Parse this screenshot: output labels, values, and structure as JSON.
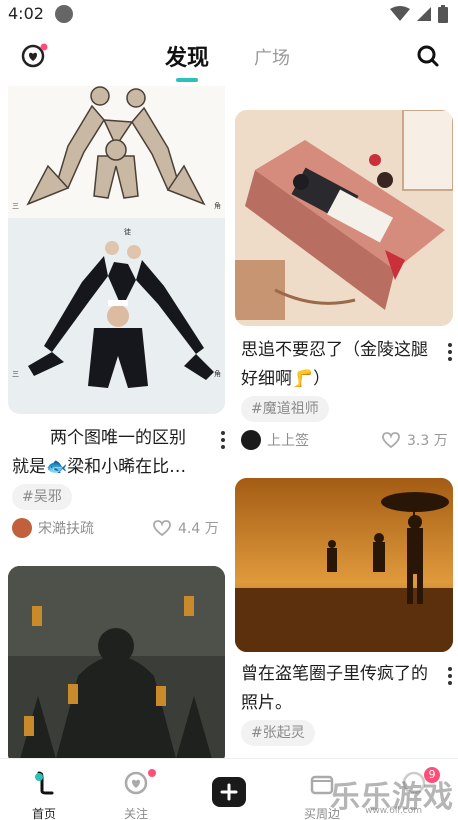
{
  "status_bar": {
    "time": "4:02"
  },
  "header": {
    "tab_discover": "发现",
    "tab_square": "广场",
    "accent_color": "#2bc3b8"
  },
  "feed": {
    "cards": [
      {
        "title": "两个图唯一的区别就是🐟梁和小晞在比…",
        "tag": "#吴邪",
        "author": "宋澔扶疏",
        "likes": "4.4 万",
        "image_caption_left": "三",
        "image_caption_right": "角"
      },
      {
        "title": "思追不要忍了（金陵这腿好细啊🦵）",
        "tag": "#魔道祖师",
        "author": "上上签",
        "likes": "3.3 万"
      },
      {
        "title": "曾在盗笔圈子里传疯了的照片。",
        "tag": "#张起灵"
      }
    ]
  },
  "bottom_nav": {
    "items": [
      {
        "label": "首页"
      },
      {
        "label": "关注"
      },
      {
        "label": "买周边"
      }
    ],
    "message_badge": "9"
  },
  "watermark": {
    "text": "乐乐游戏",
    "url": "www.6ll.com"
  }
}
